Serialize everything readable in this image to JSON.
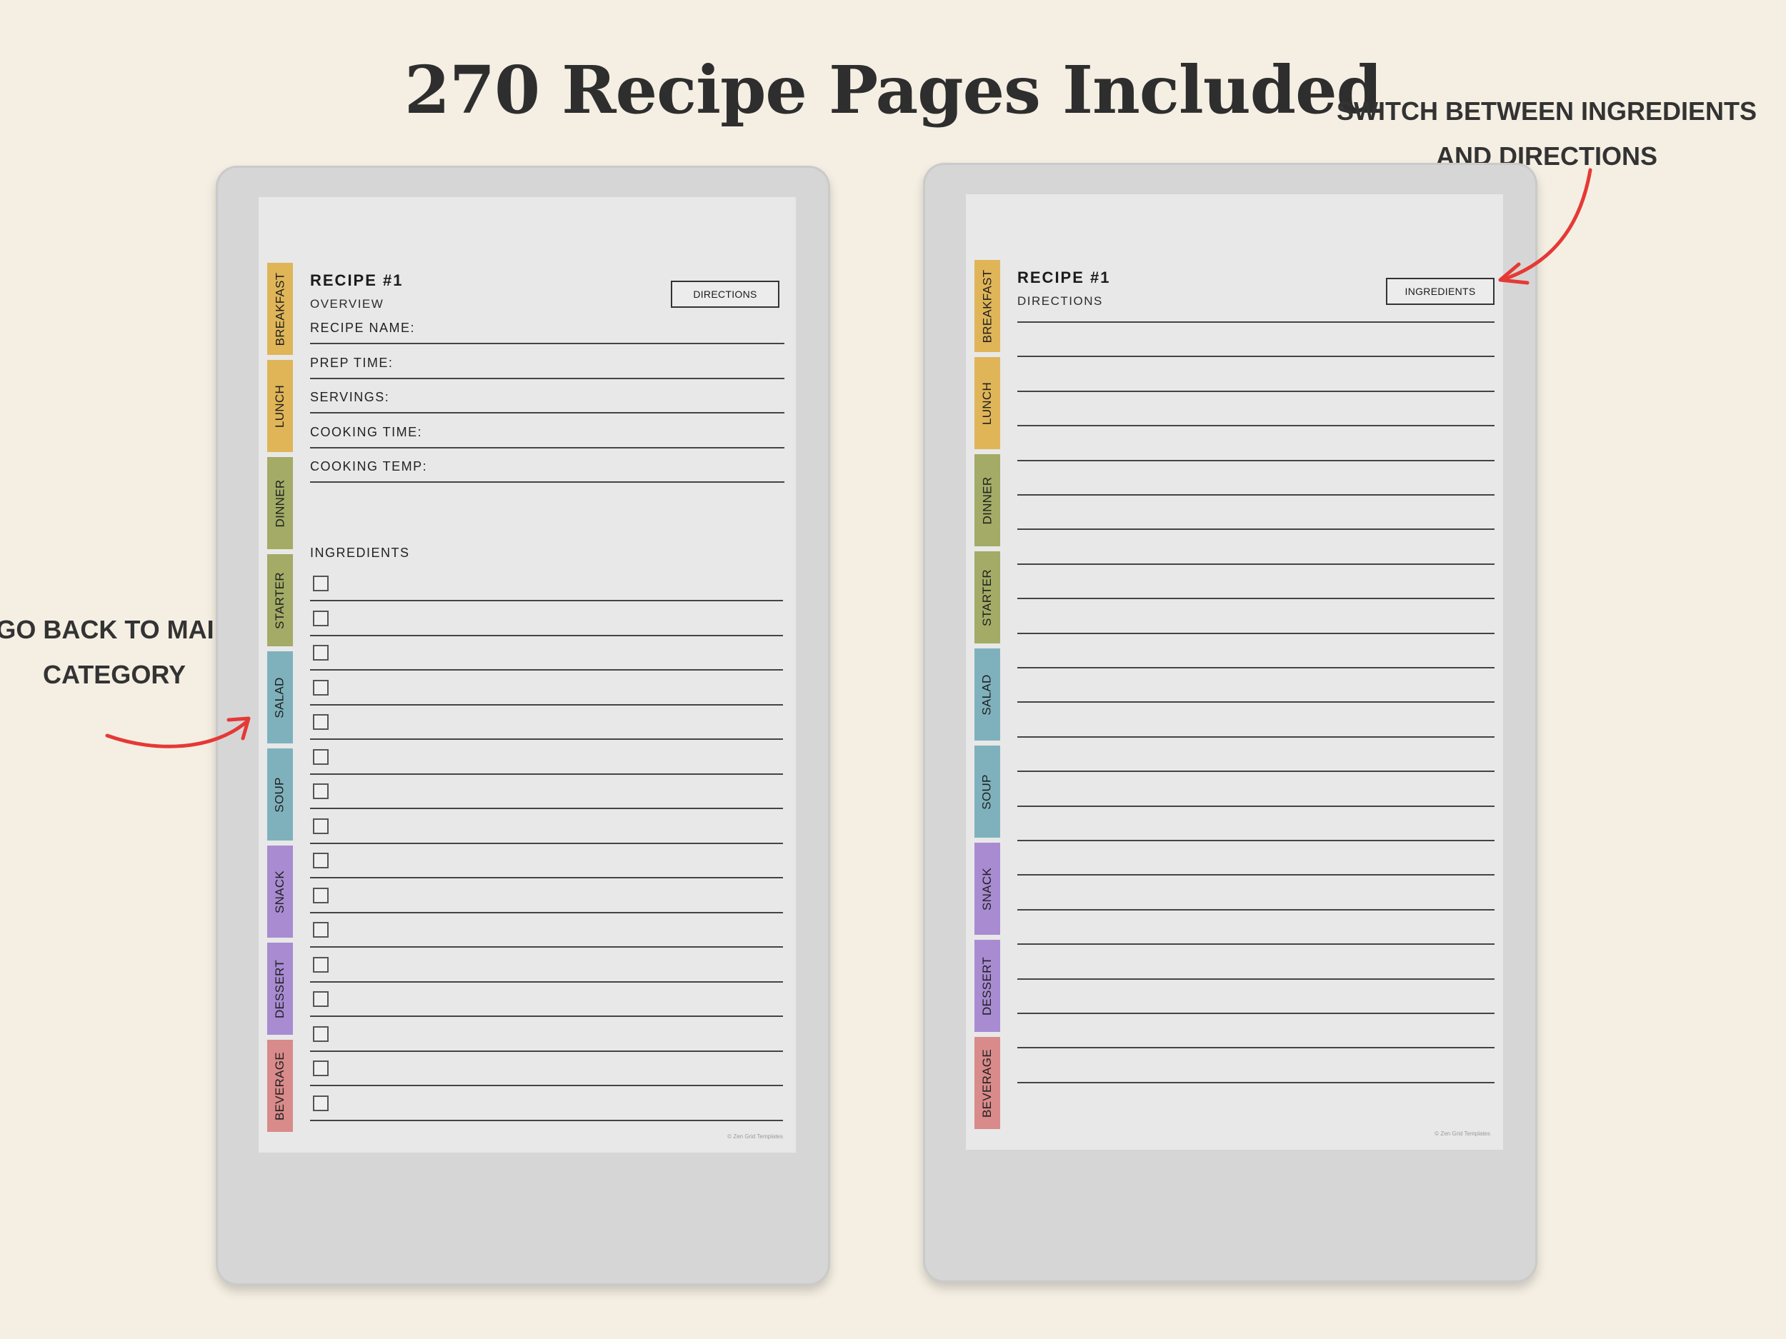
{
  "page": {
    "title": "270 Recipe Pages Included",
    "annotation_right": [
      "SWITCH BETWEEN INGREDIENTS",
      "AND DIRECTIONS"
    ],
    "annotation_left": [
      "GO BACK TO MAIN",
      "CATEGORY"
    ]
  },
  "tabs": [
    {
      "label": "BREAKFAST",
      "color": "#e0b558"
    },
    {
      "label": "LUNCH",
      "color": "#e0b558"
    },
    {
      "label": "DINNER",
      "color": "#a3ab66"
    },
    {
      "label": "STARTER",
      "color": "#a3ab66"
    },
    {
      "label": "SALAD",
      "color": "#7fb1bd"
    },
    {
      "label": "SOUP",
      "color": "#7fb1bd"
    },
    {
      "label": "SNACK",
      "color": "#a98bd2"
    },
    {
      "label": "DESSERT",
      "color": "#a98bd2"
    },
    {
      "label": "BEVERAGE",
      "color": "#d98a8a"
    }
  ],
  "left_page": {
    "title": "RECIPE #1",
    "subtitle": "OVERVIEW",
    "switch_button": "DIRECTIONS",
    "fields": [
      "RECIPE NAME:",
      "PREP TIME:",
      "SERVINGS:",
      "COOKING TIME:",
      "COOKING TEMP:"
    ],
    "ingredients_label": "INGREDIENTS",
    "ingredient_rows": 16,
    "copyright": "© Zen Grid Templates"
  },
  "right_page": {
    "title": "RECIPE #1",
    "subtitle": "DIRECTIONS",
    "switch_button": "INGREDIENTS",
    "line_rows": 23,
    "copyright": "© Zen Grid Templates"
  },
  "colors": {
    "background": "#f5efe3",
    "arrow": "#e53935",
    "device": "#d6d6d6",
    "screen": "#e8e8e8"
  }
}
